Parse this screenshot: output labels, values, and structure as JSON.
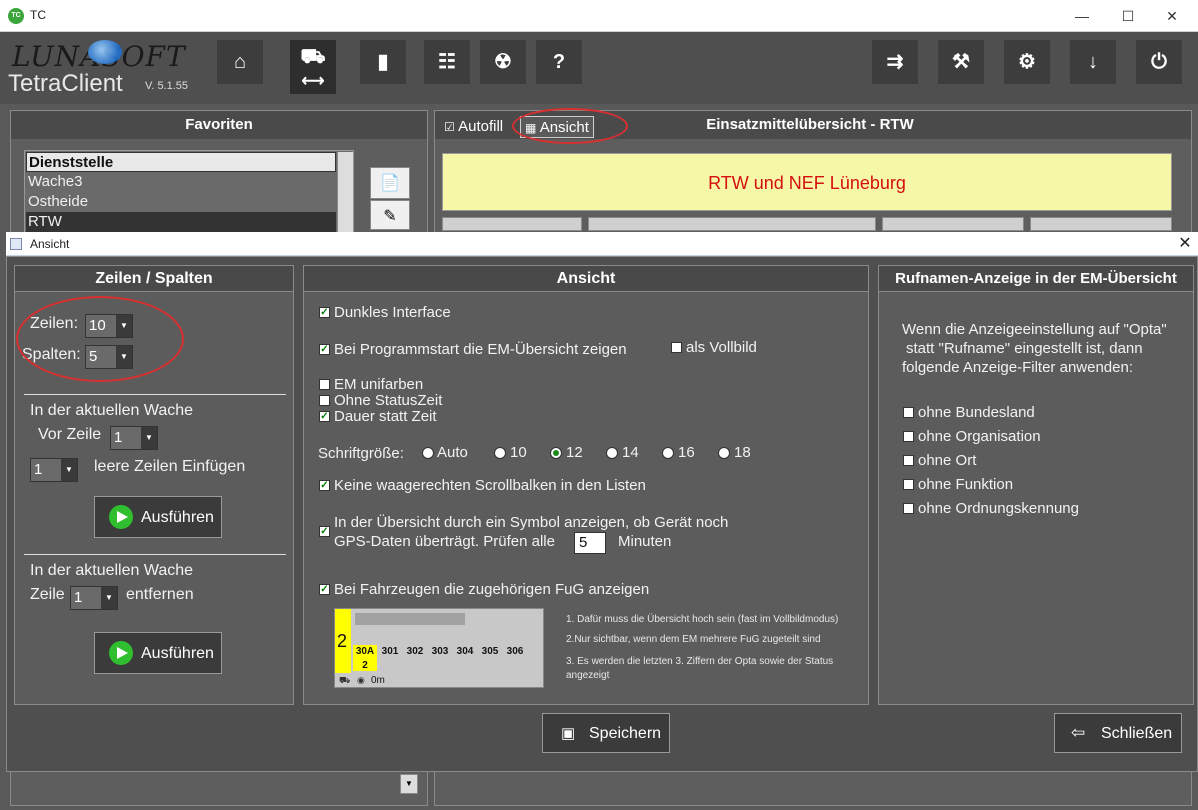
{
  "window": {
    "app_icon": "TC",
    "title": "TC",
    "minimize": "—",
    "maximize": "☐",
    "close": "✕"
  },
  "header": {
    "brand": "LUNASOFT",
    "product": "TetraClient",
    "version": "V. 5.1.55",
    "buttons": [
      {
        "icon": "home-icon",
        "glyph": "⌂"
      },
      {
        "icon": "vehicles-icon",
        "glyph": "⛟"
      },
      {
        "icon": "radio-icon",
        "glyph": "▮"
      },
      {
        "icon": "tree-icon",
        "glyph": "☷"
      },
      {
        "icon": "radiation-icon",
        "glyph": "☢"
      },
      {
        "icon": "help-icon",
        "glyph": "?"
      },
      {
        "icon": "forward-icon",
        "glyph": "⇉"
      },
      {
        "icon": "wrench-icon",
        "glyph": "⚒"
      },
      {
        "icon": "gear-icon",
        "glyph": "⚙"
      },
      {
        "icon": "download-icon",
        "glyph": "↓"
      },
      {
        "icon": "power-icon",
        "glyph": "⏻"
      }
    ],
    "swap_glyph": "⟷"
  },
  "favoriten": {
    "title": "Favoriten",
    "items": [
      "Dienststelle",
      "Wache3",
      "Ostheide",
      "RTW"
    ]
  },
  "overview": {
    "autofill_label": "Autofill",
    "ansicht_label": "Ansicht",
    "title": "Einsatzmittelübersicht - RTW",
    "banner": "RTW und NEF Lüneburg"
  },
  "dialog": {
    "title": "Ansicht",
    "close": "✕",
    "rows_cols": {
      "title": "Zeilen / Spalten",
      "rows_label": "Zeilen:",
      "rows_value": "10",
      "cols_label": "Spalten:",
      "cols_value": "5",
      "insert_header": "In der aktuellen Wache",
      "vor_zeile_label": "Vor Zeile",
      "vor_zeile_value": "1",
      "leere_value": "1",
      "leere_label": "leere Zeilen Einfügen",
      "run_label": "Ausführen",
      "remove_header": "In der aktuellen Wache",
      "zeile_label": "Zeile",
      "zeile_value": "1",
      "entfernen_label": "entfernen",
      "run2_label": "Ausführen"
    },
    "ansicht": {
      "title": "Ansicht",
      "dunkles": "Dunkles Interface",
      "programmstart": "Bei Programmstart die EM-Übersicht zeigen",
      "vollbild": "als Vollbild",
      "unifarben": "EM unifarben",
      "ohne_status": "Ohne StatusZeit",
      "dauer": "Dauer statt Zeit",
      "schrift_label": "Schriftgröße:",
      "font_sizes": [
        "Auto",
        "10",
        "12",
        "14",
        "16",
        "18"
      ],
      "font_selected": "12",
      "scrollbalken": "Keine waagerechten Scrollbalken in den Listen",
      "gps_line1": "In der Übersicht durch ein Symbol anzeigen, ob Gerät noch",
      "gps_line2": "GPS-Daten überträgt. Prüfen alle",
      "gps_minutes_value": "5",
      "gps_minutes_label": "Minuten",
      "fug": "Bei Fahrzeugen die zugehörigen FuG anzeigen",
      "preview": {
        "big_num": "2",
        "cells": [
          "30A\n2",
          "301",
          "302",
          "303",
          "304",
          "305",
          "306"
        ],
        "time": "0m"
      },
      "notes": [
        "1. Dafür muss die Übersicht hoch sein (fast im Vollbildmodus)",
        "2.Nur sichtbar, wenn dem EM mehrere FuG zugeteilt sind",
        "3. Es werden die letzten 3. Ziffern der Opta sowie der Status",
        "angezeigt"
      ]
    },
    "rufnamen": {
      "title": "Rufnamen-Anzeige in der EM-Übersicht",
      "desc1": "Wenn die Anzeigeeinstellung auf \"Opta\"",
      "desc2": "statt \"Rufname\" eingestellt ist, dann",
      "desc3": "folgende Anzeige-Filter anwenden:",
      "filters": [
        "ohne Bundesland",
        "ohne Organisation",
        "ohne Ort",
        "ohne Funktion",
        "ohne Ordnungskennung"
      ]
    },
    "save_label": "Speichern",
    "close_label": "Schließen"
  },
  "colors": {
    "accent_red": "#d41010",
    "banner_yellow": "#f7f7a8",
    "play_green": "#2fbf2f"
  }
}
